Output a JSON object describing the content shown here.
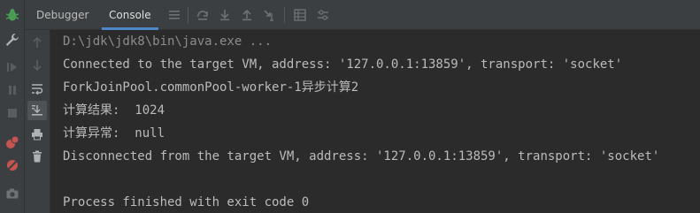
{
  "tabs": [
    {
      "label": "Debugger",
      "active": false
    },
    {
      "label": "Console",
      "active": true
    }
  ],
  "console": {
    "lines": [
      "D:\\jdk\\jdk8\\bin\\java.exe ...",
      "Connected to the target VM, address: '127.0.0.1:13859', transport: 'socket'",
      "ForkJoinPool.commonPool-worker-1异步计算2",
      "计算结果:  1024",
      "计算异常:  null",
      "Disconnected from the target VM, address: '127.0.0.1:13859', transport: 'socket'",
      "",
      "Process finished with exit code 0"
    ]
  },
  "icons": {
    "left_bar": [
      "bug-icon",
      "wrench-icon",
      "rerun-icon",
      "pause-icon",
      "stop-icon",
      "breakpoints-icon",
      "mute-breakpoints-icon",
      "camera-icon"
    ],
    "tool_strip": [
      "up-arrow-icon",
      "down-arrow-icon",
      "soft-wrap-icon",
      "scroll-to-end-icon",
      "print-icon",
      "trash-icon"
    ],
    "toolbar": [
      "menu-icon",
      "step-over-icon",
      "step-into-icon",
      "step-out-icon",
      "run-to-cursor-icon",
      "frames-icon",
      "threads-icon"
    ]
  },
  "colors": {
    "background": "#2b2b2b",
    "panel": "#3c3f41",
    "text": "#bbbbbb",
    "accent": "#4a88c7",
    "bug_green": "#499c54",
    "breakpoint_red": "#c75450"
  }
}
